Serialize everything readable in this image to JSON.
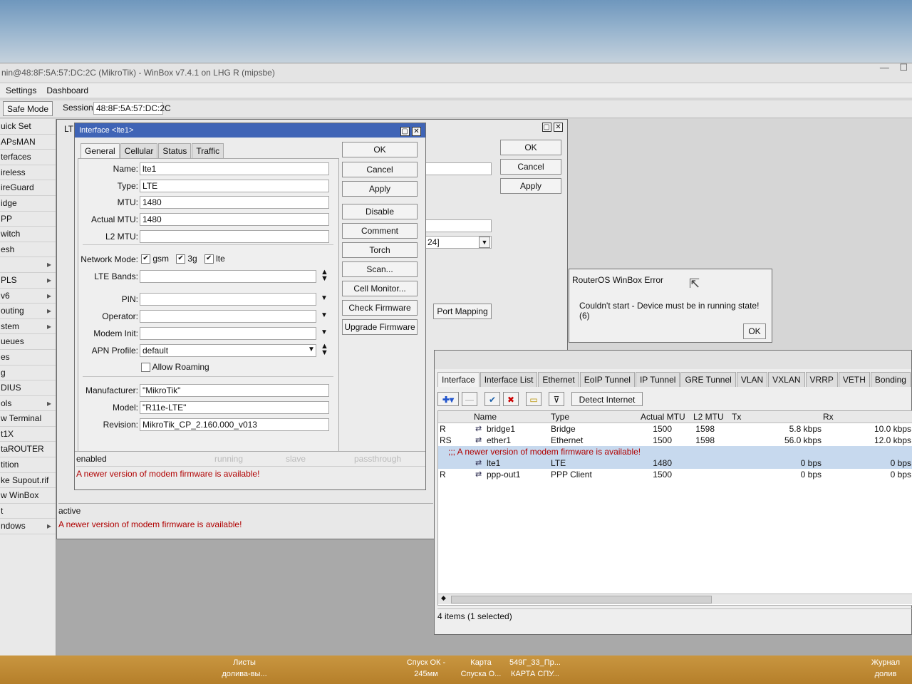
{
  "window": {
    "title": "nin@48:8F:5A:57:DC:2C (MikroTik) - WinBox v7.4.1 on LHG R (mipsbe)",
    "menu": [
      "Settings",
      "Dashboard"
    ],
    "safe_mode": "Safe Mode",
    "session_label": "Session:",
    "session_value": "48:8F:5A:57:DC:2C"
  },
  "sidebar": {
    "items": [
      {
        "label": "uick Set",
        "arrow": false
      },
      {
        "label": "APsMAN",
        "arrow": false
      },
      {
        "label": "terfaces",
        "arrow": false
      },
      {
        "label": "ireless",
        "arrow": false
      },
      {
        "label": "ireGuard",
        "arrow": false
      },
      {
        "label": "idge",
        "arrow": false
      },
      {
        "label": "PP",
        "arrow": false
      },
      {
        "label": "witch",
        "arrow": false
      },
      {
        "label": "esh",
        "arrow": false
      },
      {
        "label": "",
        "arrow": true
      },
      {
        "label": "PLS",
        "arrow": true
      },
      {
        "label": "v6",
        "arrow": true
      },
      {
        "label": "outing",
        "arrow": true
      },
      {
        "label": "stem",
        "arrow": true
      },
      {
        "label": "ueues",
        "arrow": false
      },
      {
        "label": "es",
        "arrow": false
      },
      {
        "label": "g",
        "arrow": false
      },
      {
        "label": "DIUS",
        "arrow": false
      },
      {
        "label": "ols",
        "arrow": true
      },
      {
        "label": "w Terminal",
        "arrow": false
      },
      {
        "label": "t1X",
        "arrow": false
      },
      {
        "label": "taROUTER",
        "arrow": false
      },
      {
        "label": "tition",
        "arrow": false
      },
      {
        "label": "ke Supout.rif",
        "arrow": false
      },
      {
        "label": "w WinBox",
        "arrow": false
      },
      {
        "label": "t",
        "arrow": false
      },
      {
        "label": "ndows",
        "arrow": true
      }
    ]
  },
  "lte_window": {
    "tag": "LT",
    "buttons": {
      "ok": "OK",
      "cancel": "Cancel",
      "apply": "Apply"
    },
    "port_mapping": "Port Mapping",
    "apn_fragment": "24]",
    "status_left": "active",
    "status_message": "A newer version of modem firmware is available!"
  },
  "iface_dialog": {
    "title": "Interface <lte1>",
    "tabs": [
      "General",
      "Cellular",
      "Status",
      "Traffic"
    ],
    "fields": {
      "name_label": "Name:",
      "name": "lte1",
      "type_label": "Type:",
      "type": "LTE",
      "mtu_label": "MTU:",
      "mtu": "1480",
      "actual_mtu_label": "Actual MTU:",
      "actual_mtu": "1480",
      "l2mtu_label": "L2 MTU:",
      "l2mtu": "",
      "network_mode_label": "Network Mode:",
      "mode_gsm": "gsm",
      "mode_3g": "3g",
      "mode_lte": "lte",
      "lte_bands_label": "LTE Bands:",
      "pin_label": "PIN:",
      "operator_label": "Operator:",
      "modem_init_label": "Modem Init:",
      "apn_profile_label": "APN Profile:",
      "apn_profile": "default",
      "allow_roaming": "Allow Roaming",
      "manufacturer_label": "Manufacturer:",
      "manufacturer": "\"MikroTik\"",
      "model_label": "Model:",
      "model": "\"R11e-LTE\"",
      "revision_label": "Revision:",
      "revision": "MikroTik_CP_2.160.000_v013"
    },
    "buttons": [
      "OK",
      "Cancel",
      "Apply",
      "Disable",
      "Comment",
      "Torch",
      "Scan...",
      "Cell Monitor...",
      "Check Firmware",
      "Upgrade Firmware"
    ],
    "status": {
      "enabled": "enabled",
      "running": "running",
      "slave": "slave",
      "passthrough": "passthrough"
    },
    "status_message": "A newer version of modem firmware is available!"
  },
  "error_dialog": {
    "title": "RouterOS WinBox Error",
    "message": "Couldn't start - Device must be in running state! (6)",
    "ok": "OK"
  },
  "iface_list": {
    "tabs": [
      "Interface",
      "Interface List",
      "Ethernet",
      "EoIP Tunnel",
      "IP Tunnel",
      "GRE Tunnel",
      "VLAN",
      "VXLAN",
      "VRRP",
      "VETH",
      "Bonding"
    ],
    "detect_internet": "Detect Internet",
    "columns": [
      "Name",
      "Type",
      "Actual MTU",
      "L2 MTU",
      "Tx",
      "Rx"
    ],
    "rows": [
      {
        "flag": "R",
        "name": "bridge1",
        "type": "Bridge",
        "mtu": "1500",
        "l2mtu": "1598",
        "tx": "5.8 kbps",
        "rx": "10.0 kbps"
      },
      {
        "flag": "RS",
        "name": "ether1",
        "type": "Ethernet",
        "mtu": "1500",
        "l2mtu": "1598",
        "tx": "56.0 kbps",
        "rx": "12.0 kbps"
      }
    ],
    "comment": ";;; A newer version of modem firmware is available!",
    "rows2": [
      {
        "flag": "",
        "name": "lte1",
        "type": "LTE",
        "mtu": "1480",
        "l2mtu": "",
        "tx": "0 bps",
        "rx": "0 bps"
      },
      {
        "flag": "R",
        "name": "ppp-out1",
        "type": "PPP Client",
        "mtu": "1500",
        "l2mtu": "",
        "tx": "0 bps",
        "rx": "0 bps"
      }
    ],
    "count": "4 items (1 selected)"
  },
  "taskbar": {
    "items": [
      {
        "line1": "Листы",
        "line2": "долива-вы..."
      },
      {
        "line1": "Спуск ОК -",
        "line2": "245мм"
      },
      {
        "line1": "Карта",
        "line2": "Спуска О..."
      },
      {
        "line1": "549Г_33_Пр...",
        "line2": "КАРТА СПУ..."
      },
      {
        "line1": "Журнал",
        "line2": "долив"
      }
    ]
  }
}
